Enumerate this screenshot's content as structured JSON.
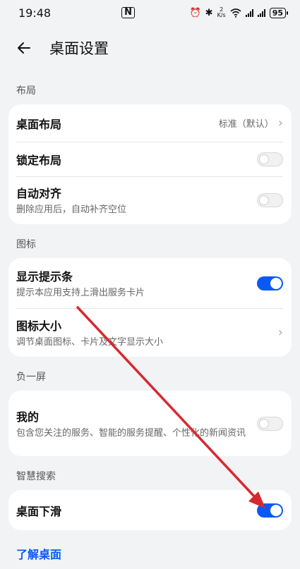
{
  "status_bar": {
    "time": "19:48",
    "nfc": "N",
    "speed_value": "2",
    "speed_unit": "K/s",
    "battery": "95"
  },
  "header": {
    "title": "桌面设置"
  },
  "sections": [
    {
      "label": "布局",
      "rows": [
        {
          "title": "桌面布局",
          "value": "标准（默认）"
        },
        {
          "title": "锁定布局",
          "toggle": false
        },
        {
          "title": "自动对齐",
          "subtitle": "删除应用后，自动补齐空位",
          "toggle": false
        }
      ]
    },
    {
      "label": "图标",
      "rows": [
        {
          "title": "显示提示条",
          "subtitle": "提示本应用支持上滑出服务卡片",
          "toggle": true
        },
        {
          "title": "图标大小",
          "subtitle": "调节桌面图标、卡片及文字显示大小"
        }
      ]
    },
    {
      "label": "负一屏",
      "rows": [
        {
          "title": "我的",
          "subtitle": "包含您关注的服务、智能的服务提醒、个性化的新闻资讯",
          "toggle": false
        }
      ]
    },
    {
      "label": "智慧搜索",
      "rows": [
        {
          "title": "桌面下滑",
          "toggle": true
        }
      ]
    }
  ],
  "footer_link": "了解桌面",
  "annotation_color": "#d8282f",
  "accent_color": "#0a59f7"
}
